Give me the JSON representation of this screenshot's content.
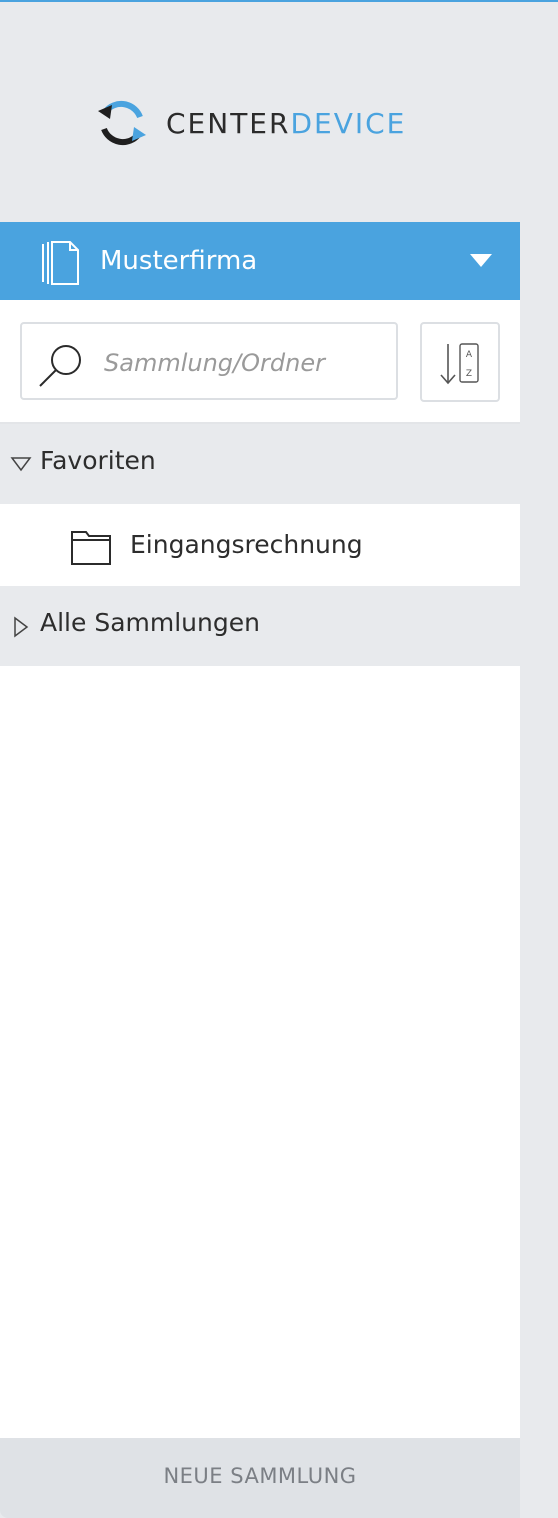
{
  "brand": {
    "name_part1": "CENTER",
    "name_part2": "DEVICE",
    "accent_color": "#4aa3df"
  },
  "organization": {
    "name": "Musterfirma",
    "icon": "documents-icon",
    "dropdown_icon": "caret-down-icon"
  },
  "search": {
    "placeholder": "Sammlung/Ordner",
    "value": "",
    "icon": "search-icon"
  },
  "sort": {
    "icon": "sort-az-icon"
  },
  "favorites": {
    "label": "Favoriten",
    "expanded": true,
    "items": [
      {
        "label": "Eingangsrechnung",
        "icon": "folder-icon"
      }
    ]
  },
  "all_collections": {
    "label": "Alle Sammlungen",
    "expanded": false
  },
  "footer": {
    "new_collection_label": "NEUE SAMMLUNG"
  }
}
